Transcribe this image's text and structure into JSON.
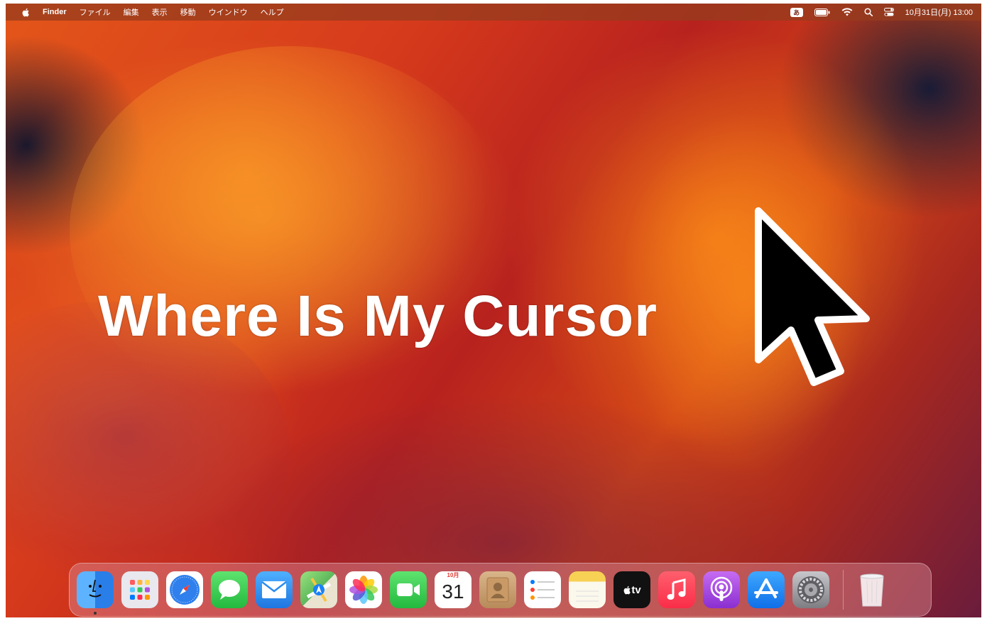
{
  "menubar": {
    "apple_icon": "apple-logo-icon",
    "app_name": "Finder",
    "menus": [
      "ファイル",
      "編集",
      "表示",
      "移動",
      "ウインドウ",
      "ヘルプ"
    ],
    "input_badge": "あ",
    "status_icons": [
      "input-method-icon",
      "battery-icon",
      "wifi-icon",
      "spotlight-search-icon",
      "control-center-icon"
    ],
    "clock": "10月31日(月) 13:00"
  },
  "headline": "Where Is My Cursor",
  "dock": {
    "apps": [
      {
        "name": "Finder",
        "icon": "finder-icon",
        "color": "#3a8ef6"
      },
      {
        "name": "Launchpad",
        "icon": "launchpad-icon",
        "color": "#e8e8ee"
      },
      {
        "name": "Safari",
        "icon": "safari-icon",
        "color": "#2f80ed"
      },
      {
        "name": "Messages",
        "icon": "messages-icon",
        "color": "#35c759"
      },
      {
        "name": "Mail",
        "icon": "mail-icon",
        "color": "#2d8cf0"
      },
      {
        "name": "Maps",
        "icon": "maps-icon",
        "color": "#6cc070"
      },
      {
        "name": "Photos",
        "icon": "photos-icon",
        "color": "#ffffff"
      },
      {
        "name": "FaceTime",
        "icon": "facetime-icon",
        "color": "#34c759"
      },
      {
        "name": "Calendar",
        "icon": "calendar-icon",
        "color": "#ffffff"
      },
      {
        "name": "Contacts",
        "icon": "contacts-icon",
        "color": "#c9a47a"
      },
      {
        "name": "Reminders",
        "icon": "reminders-icon",
        "color": "#ffffff"
      },
      {
        "name": "Notes",
        "icon": "notes-icon",
        "color": "#f7d154"
      },
      {
        "name": "TV",
        "icon": "apple-tv-icon",
        "color": "#111111"
      },
      {
        "name": "Music",
        "icon": "music-icon",
        "color": "#fa3c52"
      },
      {
        "name": "Podcasts",
        "icon": "podcasts-icon",
        "color": "#a347e0"
      },
      {
        "name": "App Store",
        "icon": "app-store-icon",
        "color": "#1c8df5"
      },
      {
        "name": "System Preferences",
        "icon": "system-preferences-icon",
        "color": "#8e8e93"
      }
    ],
    "calendar": {
      "month": "10月",
      "day": "31"
    },
    "tv_label": "tv",
    "trash": {
      "name": "Trash",
      "icon": "trash-icon"
    }
  }
}
